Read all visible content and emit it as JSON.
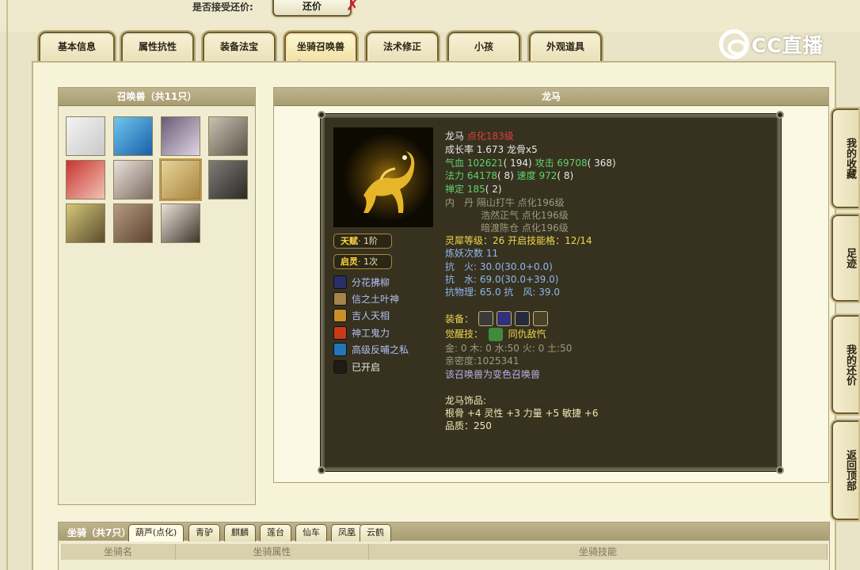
{
  "top": {
    "accept_label": "是否接受还价:",
    "counter_button": "还价"
  },
  "tabs": [
    "基本信息",
    "属性抗性",
    "装备法宝",
    "坐骑召唤兽",
    "法术修正",
    "小孩",
    "外观道具"
  ],
  "active_tab": "坐骑召唤兽",
  "logo": "CC直播",
  "summons_panel": {
    "title": "召唤兽（共11只）"
  },
  "detail_panel": {
    "title": "龙马",
    "badges": [
      {
        "name": "天赋",
        "value": "· 1阶"
      },
      {
        "name": "启灵",
        "value": "· 1次"
      }
    ],
    "skills": [
      "分花拂柳",
      "信之土叶神",
      "吉人天相",
      "神工鬼力",
      "高级反哺之私",
      "已开启"
    ],
    "info": {
      "name": "龙马",
      "level": "点化183级",
      "growth": "成长率 1.673 龙骨x5",
      "hp_label": "气血",
      "hp": "102621",
      "hp_extra": "( 194)",
      "atk_label": "攻击",
      "atk": "69708",
      "atk_extra": "( 368)",
      "mp_label": "法力",
      "mp": "64178",
      "mp_extra": "( 8)",
      "spd_label": "速度",
      "spd": "972",
      "spd_extra": "( 8)",
      "zen_label": "禅定",
      "zen": "185",
      "zen_extra": "( 2)",
      "neidan_label": "内　丹",
      "neidan": [
        "隔山打牛 点化196级",
        "浩然正气 点化196级",
        "暗渡陈仓 点化196级"
      ],
      "spirit": "灵犀等级：26  开启技能格：12/14",
      "refine": "炼妖次数 11",
      "res_fire_label": "抗　火:",
      "res_fire": "30.0",
      "res_fire_detail": "(30.0+0.0)",
      "res_water_label": "抗　水:",
      "res_water": "69.0",
      "res_water_detail": "(30.0+39.0)",
      "res_phys_label": "抗物理:",
      "res_phys": "65.0",
      "res_wind_label": "抗　风:",
      "res_wind": "39.0",
      "equip_label": "装备：",
      "awaken_label": "觉醒技：",
      "awaken": "同仇敌忾",
      "elements": "金: 0 木: 0 水:50 火: 0 土:50",
      "intimacy": "亲密度:1025341",
      "transform": "该召唤兽为变色召唤兽",
      "ornament_title": "龙马饰品:",
      "ornament_stats": "根骨 +4 灵性 +3 力量 +5 敏捷 +6",
      "quality": "品质：250"
    }
  },
  "side_buttons": [
    "我的收藏",
    "足迹",
    "我的还价",
    "返回顶部"
  ],
  "mount_panel": {
    "title": "坐骑（共7只）",
    "tabs": [
      "葫芦(点化)",
      "青驴",
      "麒麟",
      "莲台",
      "仙车",
      "凤凰",
      "云鹤"
    ],
    "columns": [
      "坐骑名",
      "坐骑属性",
      "坐骑技能"
    ]
  },
  "colors": {
    "accent_green": "#5fd36a",
    "accent_red": "#e0403d",
    "accent_gold": "#f0d64d",
    "card_bg": "#36321f",
    "panel_header": "#a89c70"
  }
}
